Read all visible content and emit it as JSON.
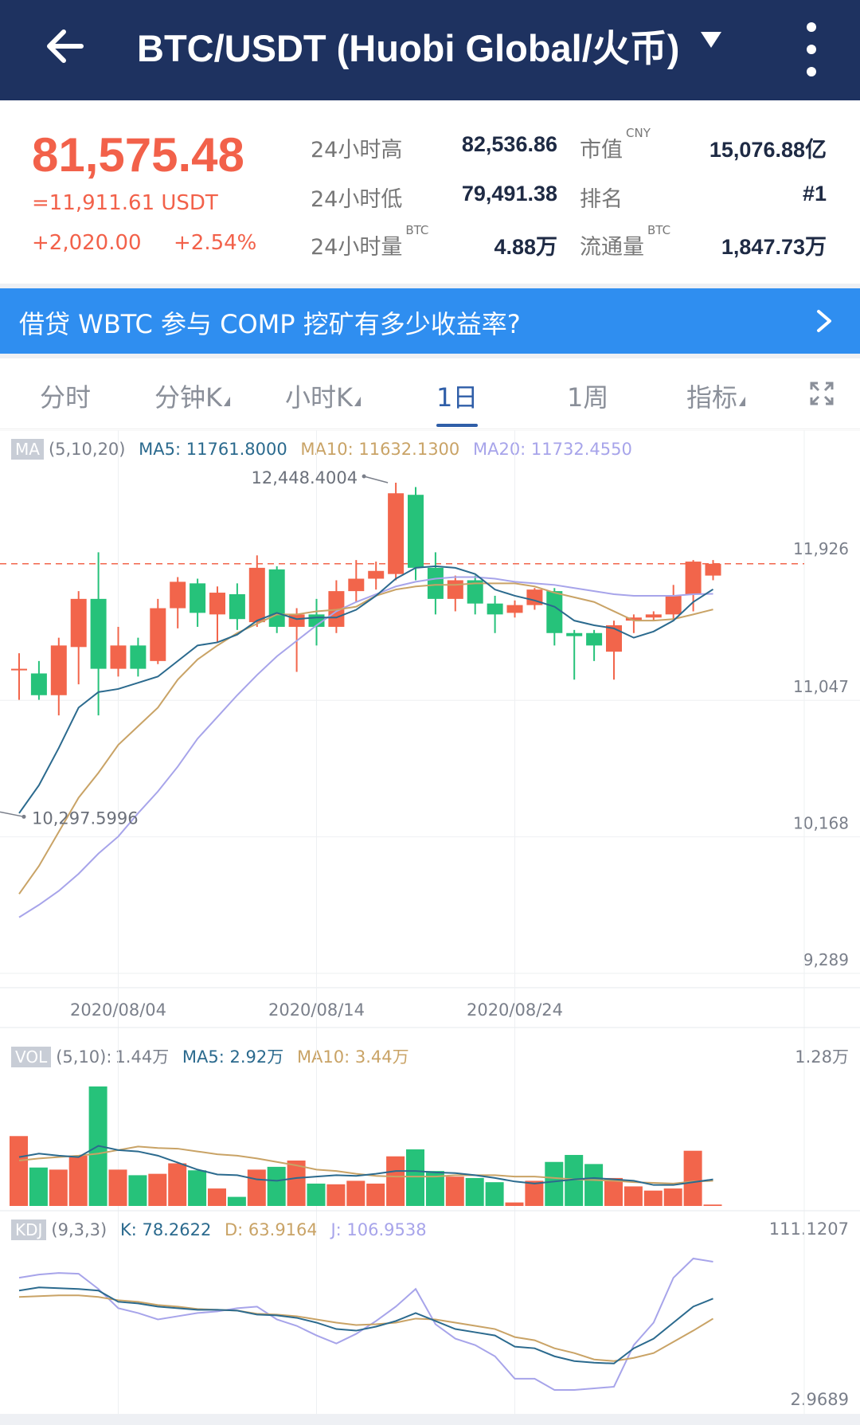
{
  "header": {
    "title": "BTC/USDT (Huobi Global/火币)",
    "back_icon": "arrow-left-icon",
    "dropdown_icon": "caret-down-icon",
    "more_icon": "more-vertical-icon"
  },
  "quote": {
    "price": "81,575.48",
    "usdt": "=11,911.61 USDT",
    "change": "+2,020.00",
    "change_pct": "+2.54%",
    "stats": [
      {
        "label": "24小时高",
        "sup": "",
        "value": "82,536.86"
      },
      {
        "label": "24小时低",
        "sup": "",
        "value": "79,491.38"
      },
      {
        "label": "24小时量",
        "sup": "BTC",
        "value": "4.88万"
      }
    ],
    "stats2": [
      {
        "label": "市值",
        "sup": "CNY",
        "value": "15,076.88亿"
      },
      {
        "label": "排名",
        "sup": "",
        "value": "#1"
      },
      {
        "label": "流通量",
        "sup": "BTC",
        "value": "1,847.73万"
      }
    ]
  },
  "banner": {
    "text": "借贷 WBTC 参与 COMP 挖矿有多少收益率?",
    "icon": "chevron-right-icon"
  },
  "tabs": [
    {
      "label": "分时",
      "caret": false
    },
    {
      "label": "分钟K",
      "caret": true
    },
    {
      "label": "小时K",
      "caret": true
    },
    {
      "label": "1日",
      "caret": false,
      "active": true
    },
    {
      "label": "1周",
      "caret": false
    },
    {
      "label": "指标",
      "caret": true
    }
  ],
  "fullscreen_icon": "expand-icon",
  "ma_legend": {
    "tag": "MA",
    "params": "(5,10,20)",
    "ma5": "MA5: 11761.8000",
    "ma10": "MA10: 11632.1300",
    "ma20": "MA20: 11732.4550"
  },
  "vol_legend": {
    "tag": "VOL",
    "params": "(5,10):",
    "value": "1.44万",
    "ma5": "MA5: 2.92万",
    "ma10": "MA10: 3.44万",
    "max": "1.28万"
  },
  "kdj_legend": {
    "tag": "KDJ",
    "params": "(9,3,3)",
    "k": "K: 78.2622",
    "d": "D: 63.9164",
    "j": "J: 106.9538",
    "max": "111.1207",
    "min": "2.9689"
  },
  "colors": {
    "up": "#f2654b",
    "down": "#26c27a",
    "ma5": "#2b6a8e",
    "ma10": "#c9a366",
    "ma20": "#a7a4ea",
    "header": "#1e3260",
    "banner": "#2f8ef0"
  },
  "chart_data": {
    "type": "candlestick",
    "x_labels": [
      "2020/08/04",
      "2020/08/14",
      "2020/08/24"
    ],
    "y_ticks": [
      "11,047",
      "10,168",
      "9,289"
    ],
    "current_price_label": "11,926",
    "current_price": 11926,
    "high_label": "12,448.4004",
    "low_label": "10,297.5996",
    "ylim": [
      9289,
      12500
    ],
    "candles": [
      {
        "o": 11250,
        "c": 11250,
        "h": 11350,
        "l": 11050
      },
      {
        "o": 11220,
        "c": 11080,
        "h": 11300,
        "l": 11050
      },
      {
        "o": 11080,
        "c": 11400,
        "h": 11450,
        "l": 10950
      },
      {
        "o": 11390,
        "c": 11700,
        "h": 11750,
        "l": 11150
      },
      {
        "o": 11700,
        "c": 11250,
        "h": 12000,
        "l": 10950
      },
      {
        "o": 11250,
        "c": 11400,
        "h": 11520,
        "l": 11200
      },
      {
        "o": 11400,
        "c": 11250,
        "h": 11450,
        "l": 11200
      },
      {
        "o": 11300,
        "c": 11640,
        "h": 11700,
        "l": 11280
      },
      {
        "o": 11640,
        "c": 11810,
        "h": 11840,
        "l": 11510
      },
      {
        "o": 11800,
        "c": 11610,
        "h": 11830,
        "l": 11520
      },
      {
        "o": 11600,
        "c": 11740,
        "h": 11780,
        "l": 11420
      },
      {
        "o": 11730,
        "c": 11570,
        "h": 11800,
        "l": 11500
      },
      {
        "o": 11550,
        "c": 11900,
        "h": 11980,
        "l": 11520
      },
      {
        "o": 11890,
        "c": 11520,
        "h": 11910,
        "l": 11480
      },
      {
        "o": 11520,
        "c": 11600,
        "h": 11640,
        "l": 11230
      },
      {
        "o": 11600,
        "c": 11520,
        "h": 11700,
        "l": 11400
      },
      {
        "o": 11520,
        "c": 11750,
        "h": 11820,
        "l": 11480
      },
      {
        "o": 11750,
        "c": 11830,
        "h": 11950,
        "l": 11680
      },
      {
        "o": 11830,
        "c": 11880,
        "h": 11940,
        "l": 11760
      },
      {
        "o": 11860,
        "c": 12380,
        "h": 12448,
        "l": 11820
      },
      {
        "o": 12370,
        "c": 11900,
        "h": 12420,
        "l": 11820
      },
      {
        "o": 11900,
        "c": 11700,
        "h": 12000,
        "l": 11600
      },
      {
        "o": 11700,
        "c": 11820,
        "h": 11850,
        "l": 11620
      },
      {
        "o": 11820,
        "c": 11670,
        "h": 11850,
        "l": 11600
      },
      {
        "o": 11670,
        "c": 11600,
        "h": 11720,
        "l": 11480
      },
      {
        "o": 11610,
        "c": 11660,
        "h": 11690,
        "l": 11580
      },
      {
        "o": 11660,
        "c": 11760,
        "h": 11770,
        "l": 11630
      },
      {
        "o": 11750,
        "c": 11480,
        "h": 11770,
        "l": 11400
      },
      {
        "o": 11480,
        "c": 11460,
        "h": 11500,
        "l": 11180
      },
      {
        "o": 11480,
        "c": 11400,
        "h": 11500,
        "l": 11300
      },
      {
        "o": 11360,
        "c": 11530,
        "h": 11560,
        "l": 11180
      },
      {
        "o": 11560,
        "c": 11580,
        "h": 11600,
        "l": 11480
      },
      {
        "o": 11580,
        "c": 11600,
        "h": 11620,
        "l": 11560
      },
      {
        "o": 11600,
        "c": 11720,
        "h": 11790,
        "l": 11560
      },
      {
        "o": 11730,
        "c": 11940,
        "h": 11950,
        "l": 11620
      },
      {
        "o": 11850,
        "c": 11926,
        "h": 11950,
        "l": 11820
      }
    ],
    "ma5": [
      10320,
      10500,
      10740,
      11000,
      11100,
      11120,
      11160,
      11200,
      11300,
      11400,
      11420,
      11470,
      11560,
      11610,
      11570,
      11580,
      11580,
      11630,
      11720,
      11830,
      11900,
      11910,
      11900,
      11860,
      11760,
      11720,
      11690,
      11650,
      11560,
      11530,
      11510,
      11450,
      11490,
      11560,
      11680,
      11761.8
    ],
    "ma10": [
      9800,
      9980,
      10200,
      10420,
      10580,
      10760,
      10880,
      11000,
      11180,
      11310,
      11400,
      11480,
      11540,
      11600,
      11600,
      11620,
      11630,
      11650,
      11720,
      11760,
      11780,
      11790,
      11790,
      11800,
      11800,
      11800,
      11780,
      11740,
      11710,
      11680,
      11620,
      11560,
      11560,
      11570,
      11600,
      11632.13
    ],
    "ma20": [
      9650,
      9730,
      9820,
      9930,
      10060,
      10170,
      10320,
      10460,
      10620,
      10800,
      10940,
      11080,
      11210,
      11330,
      11430,
      11530,
      11620,
      11680,
      11730,
      11780,
      11810,
      11830,
      11840,
      11840,
      11830,
      11810,
      11800,
      11790,
      11770,
      11750,
      11730,
      11720,
      11720,
      11720,
      11730,
      11732.455
    ],
    "volume": [
      1.0,
      0.55,
      0.52,
      0.72,
      1.71,
      0.52,
      0.44,
      0.46,
      0.61,
      0.51,
      0.25,
      0.13,
      0.52,
      0.56,
      0.65,
      0.32,
      0.31,
      0.36,
      0.32,
      0.71,
      0.81,
      0.5,
      0.42,
      0.4,
      0.34,
      0.05,
      0.36,
      0.63,
      0.73,
      0.6,
      0.4,
      0.28,
      0.22,
      0.25,
      0.79,
      0.02
    ],
    "vol_ma5": [
      0.7,
      0.75,
      0.72,
      0.7,
      0.86,
      0.8,
      0.78,
      0.72,
      0.62,
      0.52,
      0.45,
      0.44,
      0.38,
      0.36,
      0.4,
      0.42,
      0.44,
      0.43,
      0.46,
      0.5,
      0.5,
      0.48,
      0.47,
      0.44,
      0.4,
      0.35,
      0.32,
      0.35,
      0.38,
      0.4,
      0.38,
      0.36,
      0.3,
      0.3,
      0.34,
      0.38
    ],
    "vol_ma10": [
      0.65,
      0.68,
      0.7,
      0.72,
      0.75,
      0.8,
      0.85,
      0.83,
      0.82,
      0.78,
      0.74,
      0.72,
      0.68,
      0.63,
      0.58,
      0.52,
      0.5,
      0.46,
      0.43,
      0.42,
      0.42,
      0.42,
      0.44,
      0.44,
      0.44,
      0.42,
      0.42,
      0.4,
      0.38,
      0.37,
      0.36,
      0.34,
      0.33,
      0.32,
      0.35,
      0.36
    ],
    "kdj_k": [
      80,
      84,
      83,
      82,
      80,
      66,
      64,
      60,
      58,
      56,
      56,
      55,
      50,
      49,
      46,
      40,
      32,
      30,
      35,
      42,
      52,
      42,
      32,
      28,
      24,
      10,
      8,
      -2,
      -8,
      -10,
      -11,
      8,
      20,
      40,
      60,
      70
    ],
    "kdj_d": [
      72,
      73,
      74,
      74,
      72,
      68,
      66,
      62,
      60,
      57,
      56,
      55,
      51,
      50,
      48,
      44,
      40,
      37,
      38,
      40,
      45,
      44,
      40,
      36,
      32,
      22,
      18,
      8,
      2,
      -6,
      -8,
      -4,
      2,
      16,
      30,
      45
    ],
    "kdj_j": [
      96,
      100,
      102,
      101,
      82,
      58,
      52,
      44,
      48,
      52,
      54,
      58,
      60,
      44,
      36,
      24,
      14,
      26,
      42,
      60,
      82,
      38,
      20,
      12,
      -2,
      -30,
      -30,
      -44,
      -44,
      -42,
      -40,
      12,
      40,
      96,
      120,
      116
    ]
  }
}
